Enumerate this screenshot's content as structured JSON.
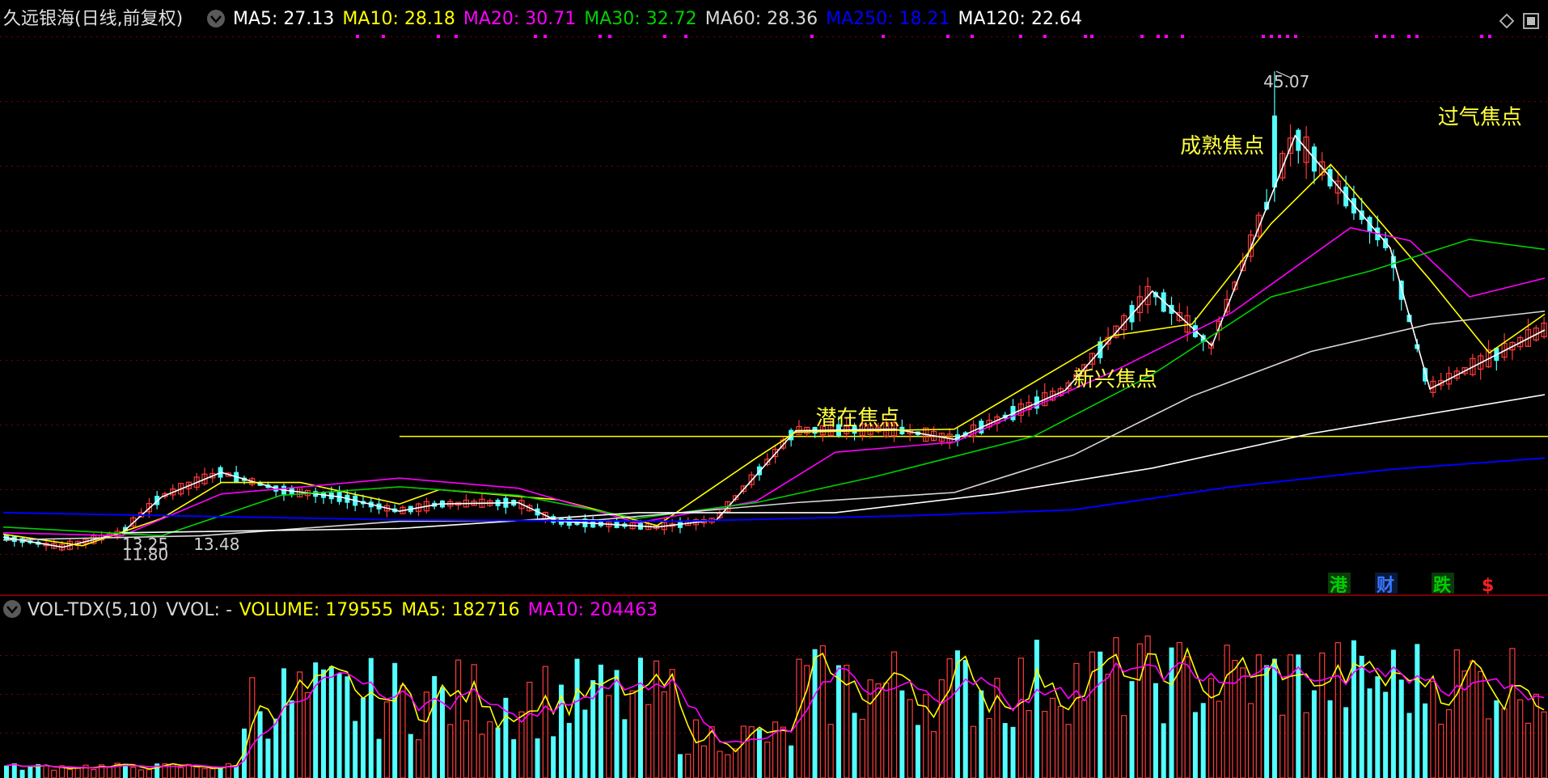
{
  "colors": {
    "background": "#000000",
    "grid": "#7a0000",
    "up": "#ff3b3b",
    "down": "#54ffff",
    "ma5": "#ffffff",
    "ma10": "#ffff00",
    "ma20": "#ff00ff",
    "ma30": "#00d000",
    "ma60": "#d8d8d8",
    "ma250": "#0000ff",
    "ma120": "#ffffff",
    "annotation": "#ffff40",
    "resistance": "#ffff00",
    "dots": "#ff00ff"
  },
  "header": {
    "stock_title": "久远银海(日线,前复权)",
    "ma_legend": [
      {
        "label": "MA5: 27.13",
        "color": "#ffffff"
      },
      {
        "label": "MA10: 28.18",
        "color": "#ffff00"
      },
      {
        "label": "MA20: 30.71",
        "color": "#ff00ff"
      },
      {
        "label": "MA30: 32.72",
        "color": "#00d000"
      },
      {
        "label": "MA60: 28.36",
        "color": "#d8d8d8"
      },
      {
        "label": "MA250: 18.21",
        "color": "#0000ff"
      },
      {
        "label": "MA120: 22.64",
        "color": "#ffffff"
      }
    ]
  },
  "volume_header": {
    "name": "VOL-TDX(5,10)",
    "vvol": "VVOL: -",
    "volume": "VOLUME: 179555",
    "ma5": "MA5: 182716",
    "ma10": "MA10: 204463"
  },
  "flags": [
    {
      "label": "港",
      "color": "#00d000",
      "bg": "#0a3a0a"
    },
    {
      "label": "财",
      "color": "#3a78ff",
      "bg": "#0a1a3a"
    },
    {
      "label": "跌",
      "color": "#00d000",
      "bg": "#0a3a0a"
    },
    {
      "label": "$",
      "color": "#ff2020",
      "bg": "#000000"
    }
  ],
  "chart_data": [
    {
      "type": "candlestick",
      "title": "久远银海(日线,前复权)",
      "ylim": [
        9.0,
        47.5
      ],
      "x_count": 196,
      "series": [
        {
          "name": "MA5",
          "last": 27.13,
          "points": [
            [
              0,
              12.7
            ],
            [
              15,
              12.0
            ],
            [
              30,
              13.0
            ],
            [
              40,
              15.5
            ],
            [
              55,
              17.2
            ],
            [
              70,
              16.0
            ],
            [
              85,
              15.5
            ],
            [
              100,
              14.5
            ],
            [
              110,
              15.0
            ],
            [
              130,
              15.1
            ],
            [
              140,
              13.8
            ],
            [
              165,
              13.4
            ],
            [
              180,
              13.9
            ],
            [
              200,
              20.1
            ],
            [
              225,
              20.2
            ],
            [
              240,
              19.5
            ],
            [
              268,
              22.9
            ],
            [
              290,
              29.8
            ],
            [
              305,
              26.0
            ],
            [
              326,
              40.6
            ],
            [
              350,
              32.8
            ],
            [
              360,
              23.0
            ],
            [
              389,
              27.1
            ]
          ]
        },
        {
          "name": "MA10",
          "last": 28.18,
          "points": [
            [
              0,
              12.9
            ],
            [
              20,
              12.1
            ],
            [
              40,
              14.0
            ],
            [
              55,
              16.5
            ],
            [
              75,
              16.5
            ],
            [
              100,
              15.0
            ],
            [
              110,
              16.0
            ],
            [
              140,
              15.3
            ],
            [
              165,
              13.5
            ],
            [
              190,
              18.2
            ],
            [
              200,
              20.0
            ],
            [
              240,
              20.2
            ],
            [
              280,
              26.7
            ],
            [
              300,
              27.5
            ],
            [
              320,
              34.5
            ],
            [
              335,
              38.6
            ],
            [
              360,
              30.6
            ],
            [
              375,
              25.5
            ],
            [
              389,
              28.2
            ]
          ]
        },
        {
          "name": "MA20",
          "last": 30.71,
          "points": [
            [
              0,
              13.0
            ],
            [
              30,
              12.8
            ],
            [
              55,
              15.7
            ],
            [
              80,
              16.3
            ],
            [
              100,
              16.8
            ],
            [
              130,
              16.1
            ],
            [
              160,
              13.7
            ],
            [
              190,
              15.2
            ],
            [
              210,
              18.6
            ],
            [
              240,
              19.3
            ],
            [
              280,
              24.2
            ],
            [
              310,
              28.3
            ],
            [
              340,
              34.2
            ],
            [
              355,
              33.3
            ],
            [
              370,
              29.4
            ],
            [
              389,
              30.7
            ]
          ]
        },
        {
          "name": "MA30",
          "last": 32.72,
          "points": [
            [
              0,
              13.4
            ],
            [
              40,
              12.8
            ],
            [
              70,
              15.6
            ],
            [
              100,
              16.2
            ],
            [
              130,
              15.6
            ],
            [
              160,
              14.0
            ],
            [
              190,
              15.1
            ],
            [
              220,
              16.9
            ],
            [
              260,
              19.7
            ],
            [
              290,
              24.0
            ],
            [
              320,
              29.4
            ],
            [
              345,
              31.2
            ],
            [
              370,
              33.4
            ],
            [
              389,
              32.7
            ]
          ]
        },
        {
          "name": "MA60",
          "last": 28.36,
          "points": [
            [
              0,
              12.5
            ],
            [
              50,
              12.8
            ],
            [
              100,
              13.8
            ],
            [
              150,
              13.9
            ],
            [
              200,
              15.1
            ],
            [
              240,
              15.8
            ],
            [
              270,
              18.4
            ],
            [
              300,
              22.5
            ],
            [
              330,
              25.6
            ],
            [
              360,
              27.5
            ],
            [
              389,
              28.4
            ]
          ]
        },
        {
          "name": "MA120",
          "last": 22.64,
          "points": [
            [
              30,
              13.0
            ],
            [
              100,
              13.3
            ],
            [
              160,
              14.4
            ],
            [
              210,
              14.4
            ],
            [
              250,
              15.7
            ],
            [
              290,
              17.5
            ],
            [
              330,
              19.9
            ],
            [
              389,
              22.6
            ]
          ]
        },
        {
          "name": "MA250",
          "last": 18.21,
          "points": [
            [
              0,
              14.4
            ],
            [
              100,
              13.9
            ],
            [
              170,
              13.8
            ],
            [
              230,
              14.2
            ],
            [
              270,
              14.6
            ],
            [
              310,
              16.2
            ],
            [
              350,
              17.4
            ],
            [
              389,
              18.2
            ]
          ]
        }
      ],
      "resistance_level": 19.7,
      "annotations": [
        {
          "text": "潜在焦点",
          "x": 205,
          "y": 20.5
        },
        {
          "text": "新兴焦点",
          "x": 270,
          "y": 23.2
        },
        {
          "text": "成熟焦点",
          "x": 297,
          "y": 39.4
        },
        {
          "text": "过气焦点",
          "x": 362,
          "y": 41.4
        }
      ],
      "price_labels": [
        {
          "text": "45.07",
          "x": 318,
          "y": 45.07
        },
        {
          "text": "13.25",
          "x": 30,
          "y": 11.8
        },
        {
          "text": "13.48",
          "x": 48,
          "y": 11.8
        },
        {
          "text": "11.80",
          "x": 30,
          "y": 11.1
        }
      ]
    },
    {
      "type": "bar",
      "title": "VOL-TDX(5,10)",
      "last_volume": 179555,
      "series": [
        {
          "name": "MA5",
          "last": 182716
        },
        {
          "name": "MA10",
          "last": 204463
        }
      ]
    }
  ]
}
